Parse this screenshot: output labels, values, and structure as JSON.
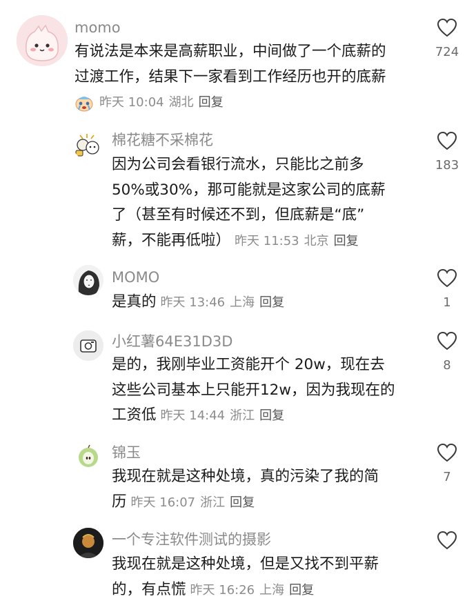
{
  "comments": [
    {
      "username": "momo",
      "lines": [
        "有说法是本来是高薪职业，中间做了一个底薪的",
        "过渡工作，结果下一家看到工作经历也开的底薪"
      ],
      "meta_prefix_emoji": "crying-face-sticker",
      "time": "昨天 10:04",
      "location": "湖北",
      "reply": "回复",
      "likes": "724",
      "avatar_icon": "pink-blob-avatar"
    },
    {
      "username": "棉花糖不采棉花",
      "lines": [
        "因为公司会看银行流水，只能比之前多",
        "50%或30%，那可能就是这家公司的底薪",
        "了（甚至有时候还不到，但底薪是“底”",
        "薪，不能再低啦）"
      ],
      "time": "昨天 11:53",
      "location": "北京",
      "reply": "回复",
      "likes": "183",
      "avatar_icon": "cartoon-sticker-avatar"
    },
    {
      "username": "MOMO",
      "lines": [
        "是真的"
      ],
      "time": "昨天 13:46",
      "location": "上海",
      "reply": "回复",
      "likes": "1",
      "avatar_icon": "sketch-portrait-avatar"
    },
    {
      "username": "小红薯64E31D3D",
      "lines": [
        "是的，我刚毕业工资能开个 20w，现在去",
        "这些公司基本上只能开12w，因为我现在的",
        "工资低"
      ],
      "time": "昨天 14:44",
      "location": "浙江",
      "reply": "回复",
      "likes": "8",
      "avatar_icon": "default-camera-avatar"
    },
    {
      "username": "锦玉",
      "lines": [
        "我现在就是这种处境，真的污染了我的简",
        "历"
      ],
      "time": "昨天 16:07",
      "location": "浙江",
      "reply": "回复",
      "likes": "7",
      "avatar_icon": "green-apple-avatar"
    },
    {
      "username": "一个专注软件测试的摄影",
      "lines": [
        "我现在就是这种处境，但是又找不到平薪",
        "的，有点慌"
      ],
      "time": "昨天 16:26",
      "location": "上海",
      "reply": "回复",
      "likes": "",
      "avatar_icon": "dark-photo-avatar"
    }
  ],
  "icons": {
    "like": "heart-outline-icon"
  },
  "colors": {
    "username": "#8a8a8a",
    "text": "#1a1a1a",
    "meta": "#8c8c8c"
  }
}
